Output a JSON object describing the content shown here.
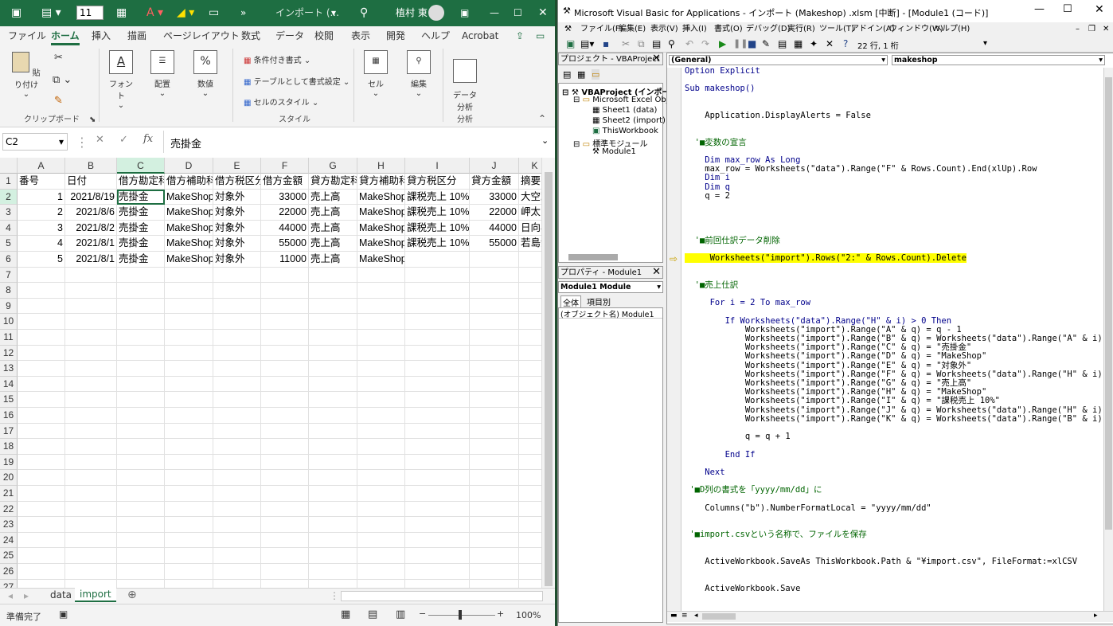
{
  "excel": {
    "title": "インポート (... ",
    "user": "植村 東",
    "font_size": "11",
    "tabs": [
      "ファイル",
      "ホーム",
      "挿入",
      "描画",
      "ページレイアウト",
      "数式",
      "データ",
      "校閲",
      "表示",
      "開発",
      "ヘルプ",
      "Acrobat"
    ],
    "ribbon": {
      "paste": "貼り付け",
      "clipboard": "クリップボード",
      "font": "フォント",
      "align": "配置",
      "number": "数値",
      "cond": "条件付き書式",
      "table": "テーブルとして書式設定",
      "cellstyle": "セルのスタイル",
      "style": "スタイル",
      "cell": "セル",
      "edit": "編集",
      "data_analysis": "データ\n分析",
      "analysis": "分析"
    },
    "namebox": "C2",
    "formula": "売掛金",
    "columns": [
      "A",
      "B",
      "C",
      "D",
      "E",
      "F",
      "G",
      "H",
      "I",
      "J",
      "K"
    ],
    "rows": [
      [
        "番号",
        "日付",
        "借方勘定科",
        "借方補助科",
        "借方税区分",
        "借方金額",
        "貸方勘定科",
        "貸方補助科",
        "貸方税区分",
        "貸方金額",
        "摘要"
      ],
      [
        "1",
        "2021/8/19",
        "売掛金",
        "MakeShop",
        "対象外",
        "33000",
        "売上高",
        "MakeShop",
        "課税売上 10%",
        "33000",
        "大空翼"
      ],
      [
        "2",
        "2021/8/6",
        "売掛金",
        "MakeShop",
        "対象外",
        "22000",
        "売上高",
        "MakeShop",
        "課税売上 10%",
        "22000",
        "岬太郎"
      ],
      [
        "3",
        "2021/8/2",
        "売掛金",
        "MakeShop",
        "対象外",
        "44000",
        "売上高",
        "MakeShop",
        "課税売上 10%",
        "44000",
        "日向小"
      ],
      [
        "4",
        "2021/8/1",
        "売掛金",
        "MakeShop",
        "対象外",
        "55000",
        "売上高",
        "MakeShop",
        "課税売上 10%",
        "55000",
        "若島津"
      ],
      [
        "5",
        "2021/8/1",
        "売掛金",
        "MakeShop",
        "対象外",
        "11000",
        "売上高",
        "MakeShop",
        "",
        "",
        ""
      ]
    ],
    "row_numbers": [
      "1",
      "2",
      "3",
      "4",
      "5",
      "6",
      "7",
      "8",
      "9",
      "10",
      "11",
      "12",
      "13",
      "14",
      "15",
      "16",
      "17",
      "18",
      "19",
      "20",
      "21",
      "22",
      "23",
      "24",
      "25",
      "26",
      "27"
    ],
    "sheets": [
      "data",
      "import"
    ],
    "status": "準備完了",
    "zoom": "100%"
  },
  "vba": {
    "title": "Microsoft Visual Basic for Applications - インポート (Makeshop) .xlsm [中断] - [Module1 (コード)]",
    "menu": [
      "ファイル(F)",
      "編集(E)",
      "表示(V)",
      "挿入(I)",
      "書式(O)",
      "デバッグ(D)",
      "実行(R)",
      "ツール(T)",
      "アドイン(A)",
      "ウィンドウ(W)",
      "ヘルプ(H)"
    ],
    "position": "22 行, 1 桁",
    "project_title": "プロジェクト - VBAProject",
    "tree": [
      "VBAProject (インポー",
      "Microsoft Excel Obj",
      "Sheet1 (data)",
      "Sheet2 (import)",
      "ThisWorkbook",
      "標準モジュール",
      "Module1"
    ],
    "props_title": "プロパティ - Module1",
    "props_select": "Module1 Module",
    "props_tabs": [
      "全体",
      "項目別"
    ],
    "props_row": "(オブジェクト名) Module1",
    "combo_left": "(General)",
    "combo_right": "makeshop",
    "code": [
      "Option Explicit",
      "",
      "Sub makeshop()",
      "",
      "",
      "    Application.DisplayAlerts = False",
      "",
      "",
      "  '■変数の宣言",
      "",
      "    Dim max_row As Long",
      "    max_row = Worksheets(\"data\").Range(\"F\" & Rows.Count).End(xlUp).Row",
      "    Dim i",
      "    Dim q",
      "    q = 2",
      "",
      "",
      "",
      "",
      "  '■前回仕訳データ削除",
      "",
      "     Worksheets(\"import\").Rows(\"2:\" & Rows.Count).Delete",
      "",
      "",
      "  '■売上仕訳",
      "",
      "     For i = 2 To max_row",
      "",
      "        If Worksheets(\"data\").Range(\"H\" & i) > 0 Then",
      "            Worksheets(\"import\").Range(\"A\" & q) = q - 1",
      "            Worksheets(\"import\").Range(\"B\" & q) = Worksheets(\"data\").Range(\"A\" & i)",
      "            Worksheets(\"import\").Range(\"C\" & q) = \"売掛金\"",
      "            Worksheets(\"import\").Range(\"D\" & q) = \"MakeShop\"",
      "            Worksheets(\"import\").Range(\"E\" & q) = \"対象外\"",
      "            Worksheets(\"import\").Range(\"F\" & q) = Worksheets(\"data\").Range(\"H\" & i)",
      "            Worksheets(\"import\").Range(\"G\" & q) = \"売上高\"",
      "            Worksheets(\"import\").Range(\"H\" & q) = \"MakeShop\"",
      "            Worksheets(\"import\").Range(\"I\" & q) = \"課税売上 10%\"",
      "            Worksheets(\"import\").Range(\"J\" & q) = Worksheets(\"data\").Range(\"H\" & i)",
      "            Worksheets(\"import\").Range(\"K\" & q) = Worksheets(\"data\").Range(\"B\" & i) & \" \"",
      "",
      "            q = q + 1",
      "",
      "        End If",
      "",
      "    Next",
      "",
      " '■D列の書式を「yyyy/mm/dd」に",
      "",
      "    Columns(\"b\").NumberFormatLocal = \"yyyy/mm/dd\"",
      "",
      "",
      " '■import.csvという名称で、ファイルを保存",
      "",
      "",
      "    ActiveWorkbook.SaveAs ThisWorkbook.Path & \"¥import.csv\", FileFormat:=xlCSV",
      "",
      "",
      "    ActiveWorkbook.Save"
    ]
  },
  "colors": {
    "excel_green": "#1e6e42",
    "highlight": "#ffff00",
    "comment": "#006400",
    "keyword": "#00008b"
  }
}
